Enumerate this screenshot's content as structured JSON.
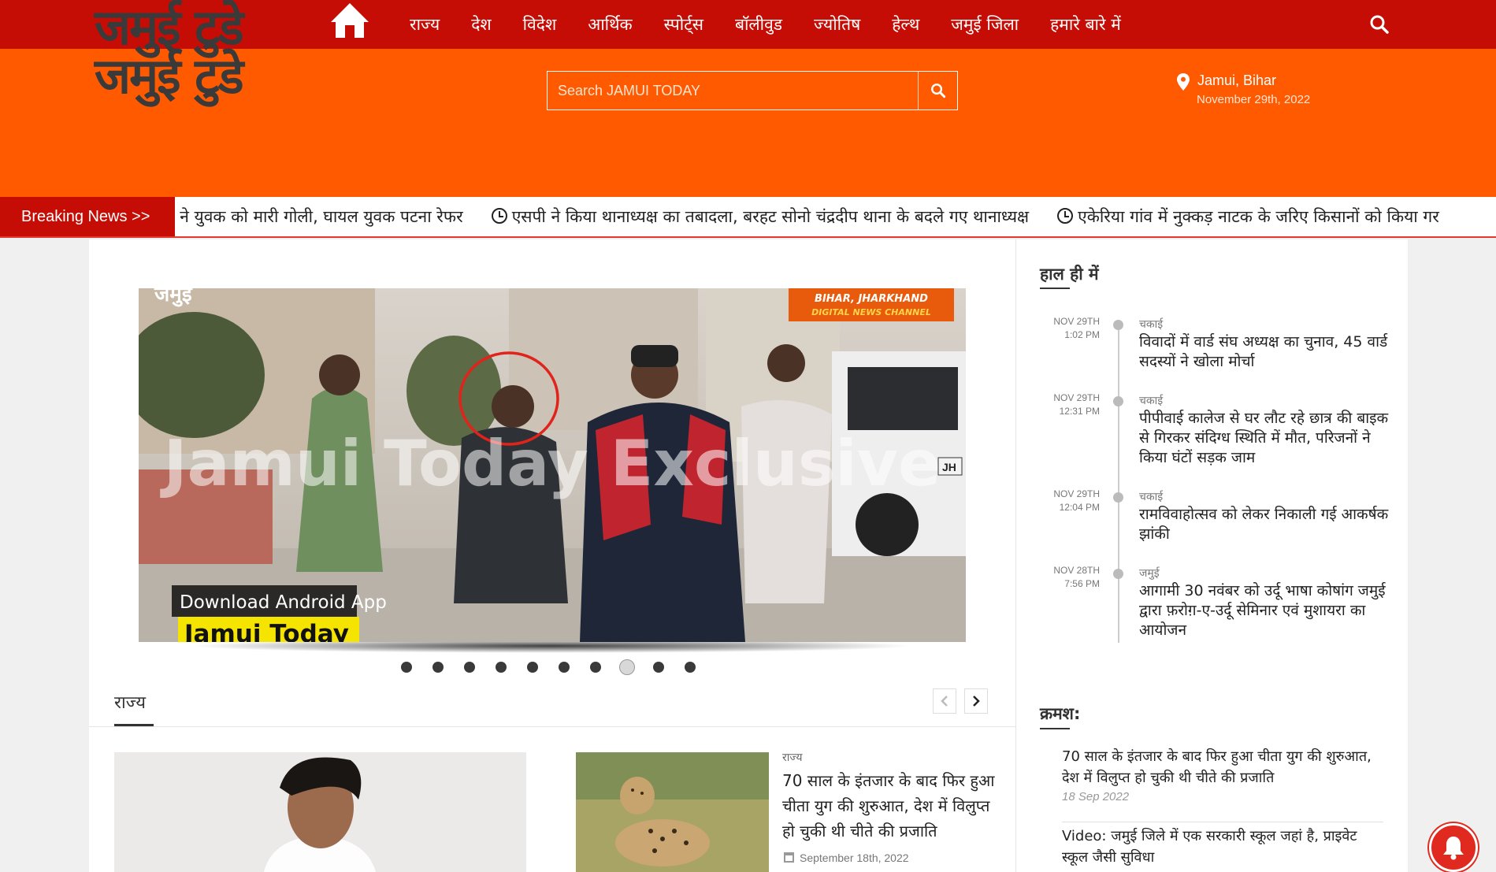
{
  "header": {
    "logo_text_1": "जमुई टुडे",
    "logo_text_2": "जमुई टुडे",
    "nav": [
      "राज्य",
      "देश",
      "विदेश",
      "आर्थिक",
      "स्पोर्ट्स",
      "बॉलीवुड",
      "ज्योतिष",
      "हेल्थ",
      "जमुई जिला",
      "हमारे बारे में"
    ],
    "search_placeholder": "Search JAMUI TODAY",
    "location": "Jamui, Bihar",
    "date": "November 29th, 2022"
  },
  "breaking": {
    "label": "Breaking News  >>",
    "items": [
      "ियों ने युवक को मारी गोली, घायल युवक पटना रेफर",
      "एसपी ने किया थानाध्यक्ष का तबादला, बरहट सोनो चंद्रदीप थाना के बदले गए थानाध्यक्ष",
      "एकेरिया गांव में नुक्कड़ नाटक के जरिए किसानों को किया गर"
    ]
  },
  "slider": {
    "badge_1": "BIHAR, JHARKHAND",
    "badge_2": "DIGITAL NEWS CHANNEL",
    "watermark": "Jamui Today Exclusive",
    "corner_text": "जमुई",
    "download_text": "Download Android App",
    "app_name": "Jamui Today",
    "plate_text": "JH",
    "dot_count": 10,
    "active_dot": 8
  },
  "section": {
    "title": "राज्य"
  },
  "card2": {
    "category": "राज्य",
    "title": "70 साल के इंतजार के बाद फिर हुआ चीता युग की शुरुआत, देश में विलुप्त हो चुकी थी चीते की प्रजाति",
    "date": "September 18th, 2022"
  },
  "sidebar": {
    "recent_title": "हाल ही में",
    "recent": [
      {
        "time": "NOV 29TH\n1:02 PM",
        "category": "चकाई",
        "title": "विवादों में वार्ड संघ अध्यक्ष का चुनाव, 45 वार्ड सदस्यों ने खोला मोर्चा"
      },
      {
        "time": "NOV 29TH\n12:31 PM",
        "category": "चकाई",
        "title": "पीपीवाई कालेज से घर लौट रहे छात्र की बाइक से गिरकर संदिग्ध स्थिति में मौत, परिजनों ने किया घंटों सड़क जाम"
      },
      {
        "time": "NOV 29TH\n12:04 PM",
        "category": "चकाई",
        "title": "रामविवाहोत्सव को लेकर निकाली गई आकर्षक झांकी"
      },
      {
        "time": "NOV 28TH\n7:56 PM",
        "category": "जमुई",
        "title": "आगामी 30 नवंबर को उर्दू भाषा कोषांग जमुई द्वारा फ़रोग़-ए-उर्दू सेमिनार एवं मुशायरा का आयोजन"
      }
    ],
    "kramash_title": "क्रमश:",
    "kramash": [
      {
        "title": "70 साल के इंतजार के बाद फिर हुआ चीता युग की शुरुआत, देश में विलुप्त हो चुकी थी चीते की प्रजाति",
        "date": "18 Sep 2022"
      },
      {
        "title": "Video: जमुई जिले में एक सरकारी स्कूल जहां है, प्राइवेट स्कूल जैसी सुविधा",
        "date": ""
      }
    ]
  },
  "colors": {
    "nav_red": "#c60d05",
    "header_orange": "#ff5a00",
    "accent_red": "#e02a1f"
  }
}
